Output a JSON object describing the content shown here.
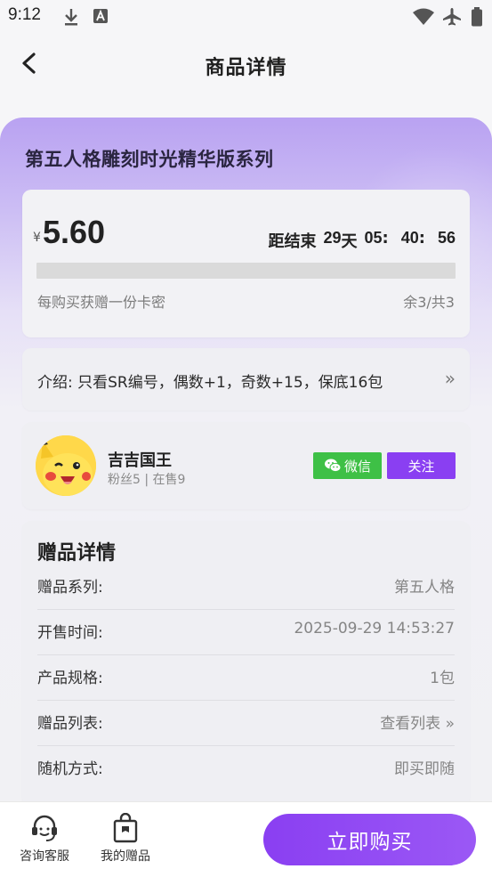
{
  "status_bar": {
    "time": "9:12"
  },
  "header": {
    "title": "商品详情"
  },
  "product": {
    "series_title": "第五人格雕刻时光精华版系列",
    "currency_symbol": "¥",
    "price": "5.60",
    "countdown": {
      "label": "距结束",
      "days": "29",
      "days_unit": "天",
      "hours": "05",
      "sep1": ":",
      "minutes": "40",
      "sep2": ":",
      "seconds": "56"
    },
    "progress_fraction": 0,
    "gift_note": "每购买获赠一份卡密",
    "stock": "余3/共3"
  },
  "intro": {
    "text": "介绍: 只看SR编号，偶数+1，奇数+15，保底16包",
    "arrow": "»"
  },
  "seller": {
    "name": "吉吉国王",
    "meta": "粉丝5 | 在售9",
    "wechat_label": "微信",
    "follow_label": "关注"
  },
  "details": {
    "heading": "赠品详情",
    "rows": [
      {
        "key": "赠品系列:",
        "value": "第五人格"
      },
      {
        "key": "开售时间:",
        "value": "2025-09-29 14:53:27"
      },
      {
        "key": "产品规格:",
        "value": "1包"
      },
      {
        "key": "赠品列表:",
        "value": "查看列表 »"
      },
      {
        "key": "随机方式:",
        "value": "即买即随"
      }
    ]
  },
  "bottom_bar": {
    "service_label": "咨询客服",
    "gifts_label": "我的赠品",
    "buy_label": "立即购买"
  },
  "colors": {
    "accent": "#8a3ff2",
    "wechat": "#3ec046",
    "gradient_top": "#b9a2f2"
  }
}
